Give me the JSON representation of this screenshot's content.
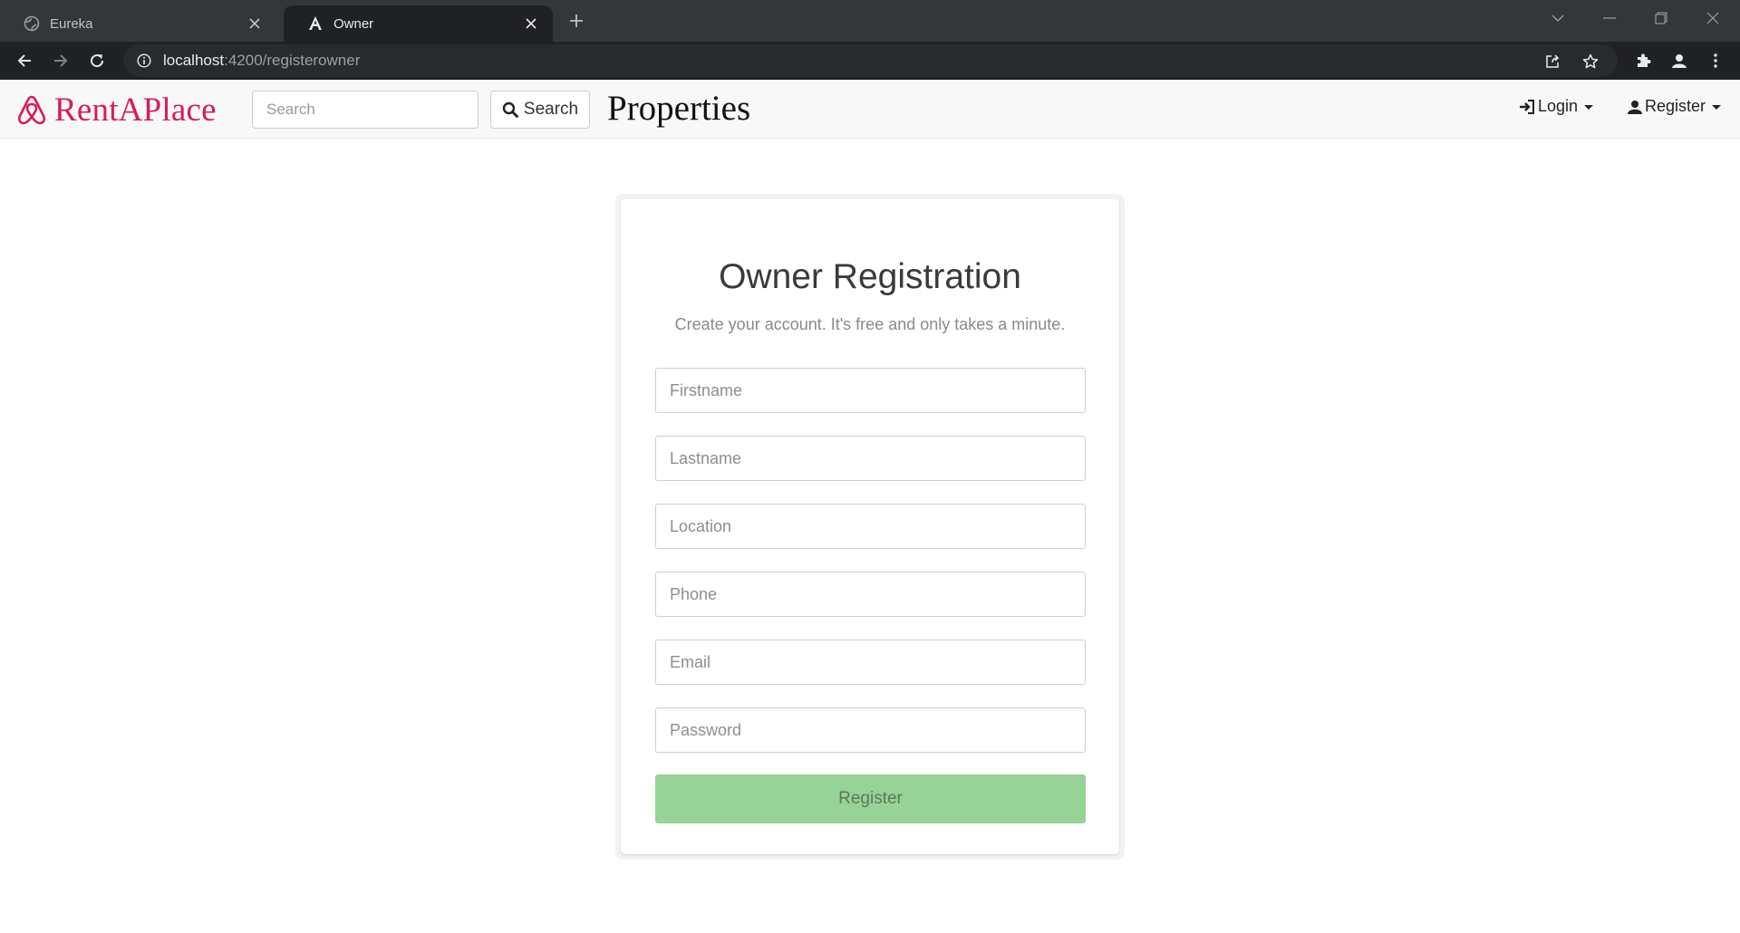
{
  "browser": {
    "tabs": [
      {
        "title": "Eureka",
        "icon": "globe-icon",
        "active": false
      },
      {
        "title": "Owner",
        "icon": "angular-icon",
        "active": true
      }
    ],
    "url_host": "localhost",
    "url_path": ":4200/registerowner"
  },
  "navbar": {
    "brand": "RentAPlace",
    "search_placeholder": "Search",
    "search_button": "Search",
    "section_title": "Properties",
    "login_label": "Login",
    "register_label": "Register"
  },
  "form": {
    "title": "Owner Registration",
    "subtitle": "Create your account. It's free and only takes a minute.",
    "fields": {
      "firstname": "Firstname",
      "lastname": "Lastname",
      "location": "Location",
      "phone": "Phone",
      "email": "Email",
      "password": "Password"
    },
    "submit_label": "Register",
    "submit_color": "#97d296"
  },
  "colors": {
    "brand": "#d81b60",
    "chrome_dark": "#202124",
    "tabstrip": "#35363a"
  }
}
